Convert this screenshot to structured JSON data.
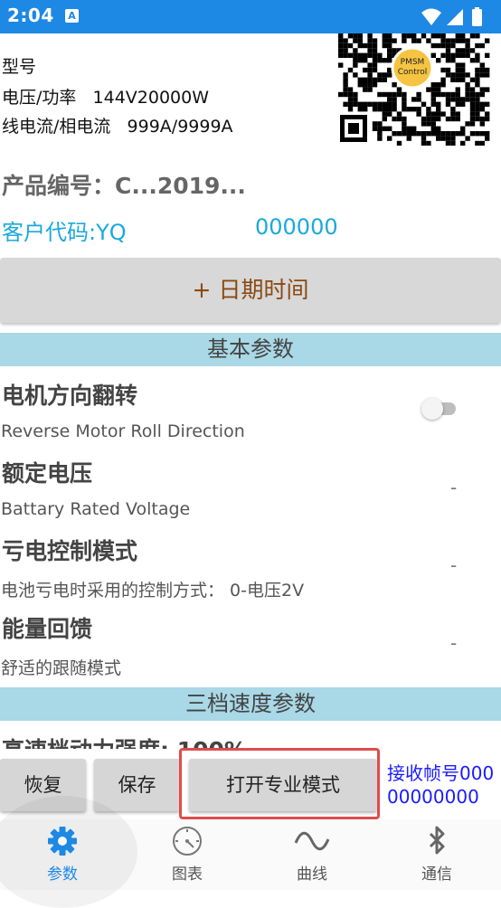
{
  "status_bar": {
    "time": "2:04",
    "notification_glyph": "A",
    "icons": [
      "wifi-icon",
      "signal-icon",
      "battery-icon"
    ]
  },
  "device_info": {
    "model_label": "型号",
    "voltage_power_label": "电压/功率",
    "voltage_power_value": "144V20000W",
    "current_label": "线电流/相电流",
    "current_value": "999A/9999A",
    "qr_logo_line1": "PMSM",
    "qr_logo_line2": "Control"
  },
  "product": {
    "code_text": "产品编号：C...2019..."
  },
  "customer": {
    "code_text": "客户代码:YQ",
    "number": "000000"
  },
  "date_button": {
    "label": "+ 日期时间"
  },
  "sections": {
    "basic": "基本参数",
    "speed": "三档速度参数"
  },
  "params": [
    {
      "title": "电机方向翻转",
      "subtitle": "Reverse Motor Roll Direction",
      "control": "toggle",
      "value": "off"
    },
    {
      "title": "额定电压",
      "subtitle": "Battary Rated Voltage",
      "control": "value",
      "value": "-"
    },
    {
      "title": "亏电控制模式",
      "subtitle": "电池亏电时采用的控制方式： 0-电压2V",
      "control": "value",
      "value": "-"
    },
    {
      "title": "能量回馈",
      "subtitle": "舒适的跟随模式",
      "control": "value",
      "value": "-"
    }
  ],
  "partial_param": {
    "title": "高速档动力强度: 100%"
  },
  "actions": {
    "restore": "恢复",
    "save": "保存",
    "pro_mode": "打开专业模式"
  },
  "frame_counter": {
    "text": "接收帧号00000000000"
  },
  "nav": [
    {
      "label": "参数",
      "icon": "gear-icon",
      "active": true
    },
    {
      "label": "图表",
      "icon": "gauge-icon",
      "active": false
    },
    {
      "label": "曲线",
      "icon": "wave-icon",
      "active": false
    },
    {
      "label": "通信",
      "icon": "bluetooth-icon",
      "active": false
    }
  ],
  "colors": {
    "primary": "#1e88e5",
    "accent_cyan": "#1aa9dd",
    "section_bg": "#a9d8e6",
    "highlight_red": "#e04b4b",
    "frame_blue": "#1a1aff",
    "date_text": "#8a4a12"
  }
}
